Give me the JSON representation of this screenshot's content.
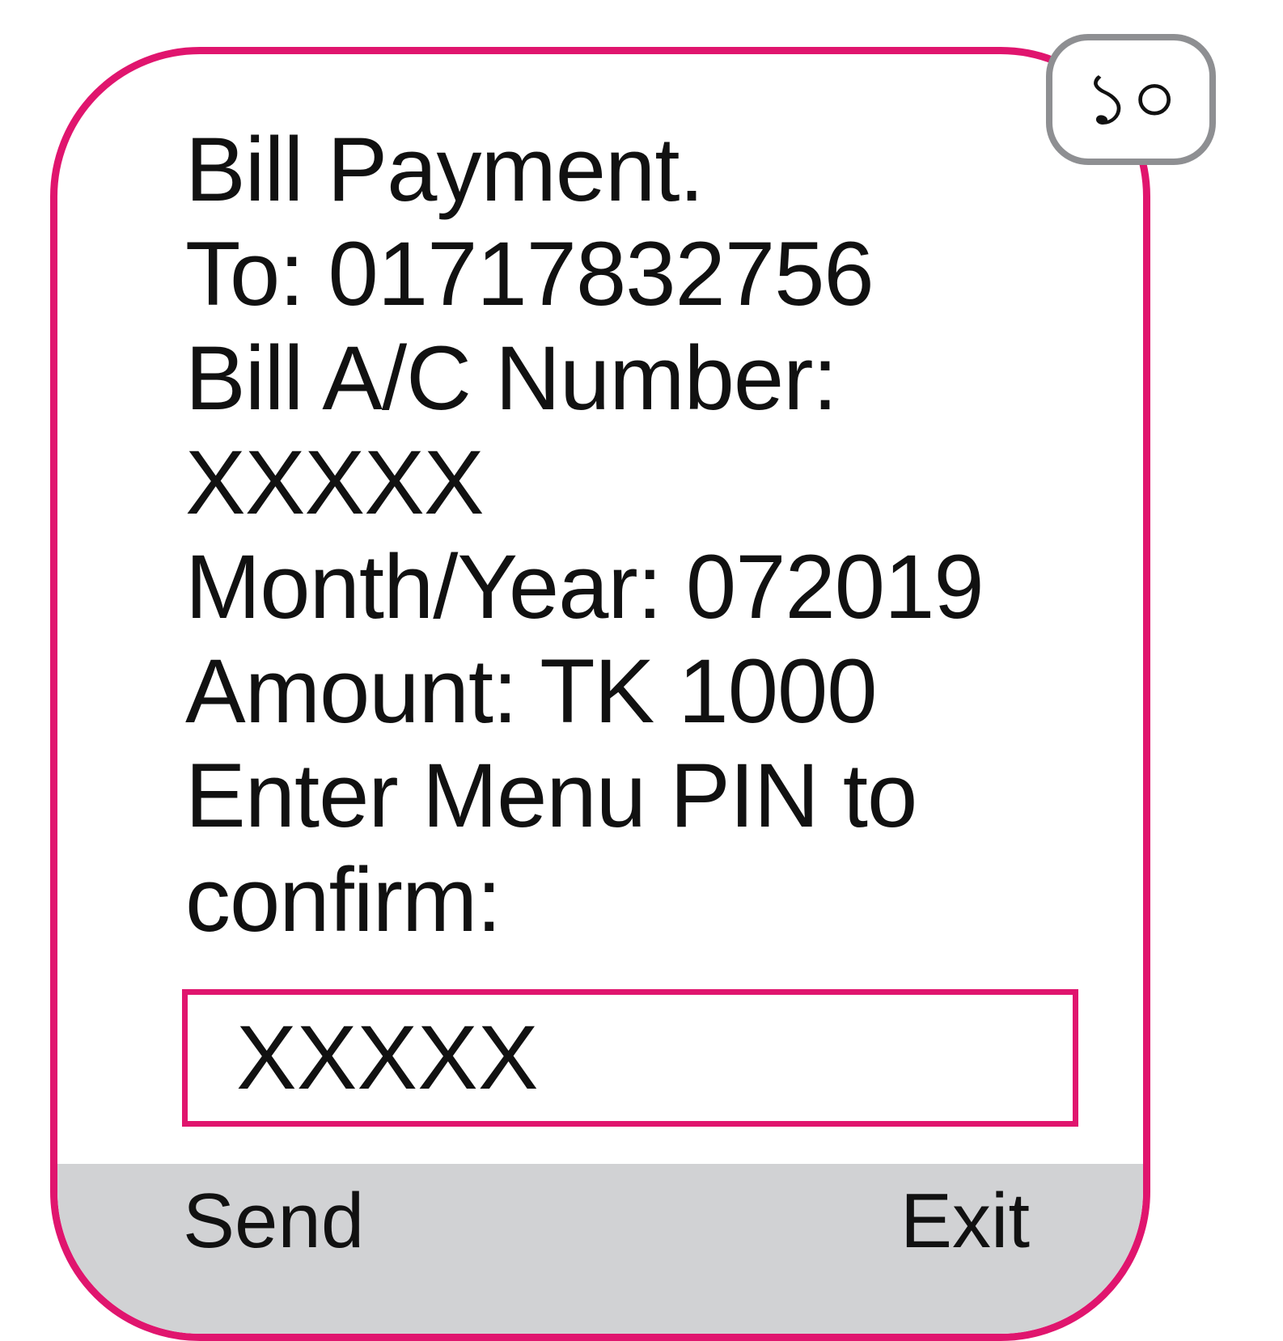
{
  "screen": {
    "message_lines": [
      "Bill Payment.",
      "To: 01717832756",
      "Bill A/C Number:",
      "XXXXX",
      "Month/Year: 072019",
      "Amount: TK 1000",
      "Enter Menu PIN to",
      "confirm:"
    ],
    "pin_input_value": "XXXXX"
  },
  "softkeys": {
    "left_label": "Send",
    "right_label": "Exit"
  },
  "step_badge": {
    "number": "১০"
  },
  "colors": {
    "frame_accent": "#e0156e",
    "softkey_bar": "#d1d2d4",
    "badge_border": "#8e8f92"
  }
}
